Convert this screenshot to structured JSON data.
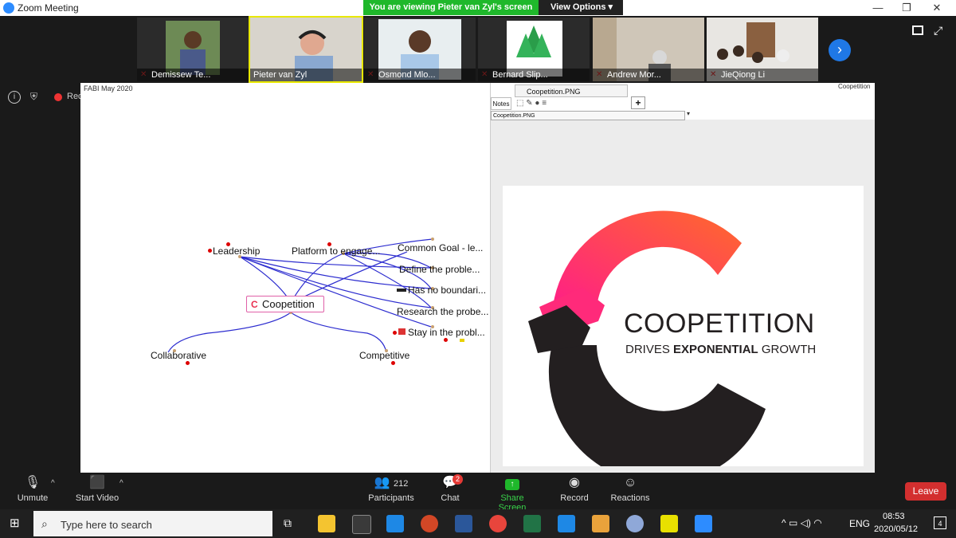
{
  "window": {
    "title": "Zoom Meeting"
  },
  "banner": {
    "viewing": "You are viewing Pieter van Zyl's screen",
    "view_options": "View Options"
  },
  "participants_tiles": [
    {
      "name": "Demissew Te..."
    },
    {
      "name": "Pieter van Zyl"
    },
    {
      "name": "Osmond Mlo..."
    },
    {
      "name": "Bernard Slip..."
    },
    {
      "name": "Andrew Mor..."
    },
    {
      "name": "JieQiong Li"
    }
  ],
  "left_status": {
    "rec": "Rec"
  },
  "shared_screen": {
    "left_title": "FABI May 2020",
    "right_label": "Coopetition",
    "tab_name": "Coopetition.PNG",
    "notes_label": "Notes",
    "add_tab": "+",
    "path": "Coopetition.PNG",
    "mindmap": {
      "center": "Coopetition",
      "nodes": [
        "Leadership",
        "Platform to engage...",
        "Common Goal  - le...",
        "Define  the proble...",
        "Has no boundari...",
        "Research the probe...",
        "Stay in the probl...",
        "Collaborative",
        "Competitive"
      ]
    },
    "logo": {
      "title": "COOPETITION",
      "sub_a": "DRIVES ",
      "sub_b": "EXPONENTIAL",
      "sub_c": " GROWTH"
    }
  },
  "toolbar": {
    "unmute": "Unmute",
    "start_video": "Start Video",
    "participants": "Participants",
    "participants_count": "212",
    "chat": "Chat",
    "chat_badge": "2",
    "share_screen": "Share Screen",
    "record": "Record",
    "reactions": "Reactions",
    "leave": "Leave"
  },
  "taskbar": {
    "search_placeholder": "Type here to search",
    "lang": "ENG",
    "time": "08:53",
    "date": "2020/05/12",
    "notif_count": "4"
  },
  "colors": {
    "zoom_blue": "#2d8cff",
    "share_green": "#1fb82b",
    "leave_red": "#d32f2f"
  }
}
